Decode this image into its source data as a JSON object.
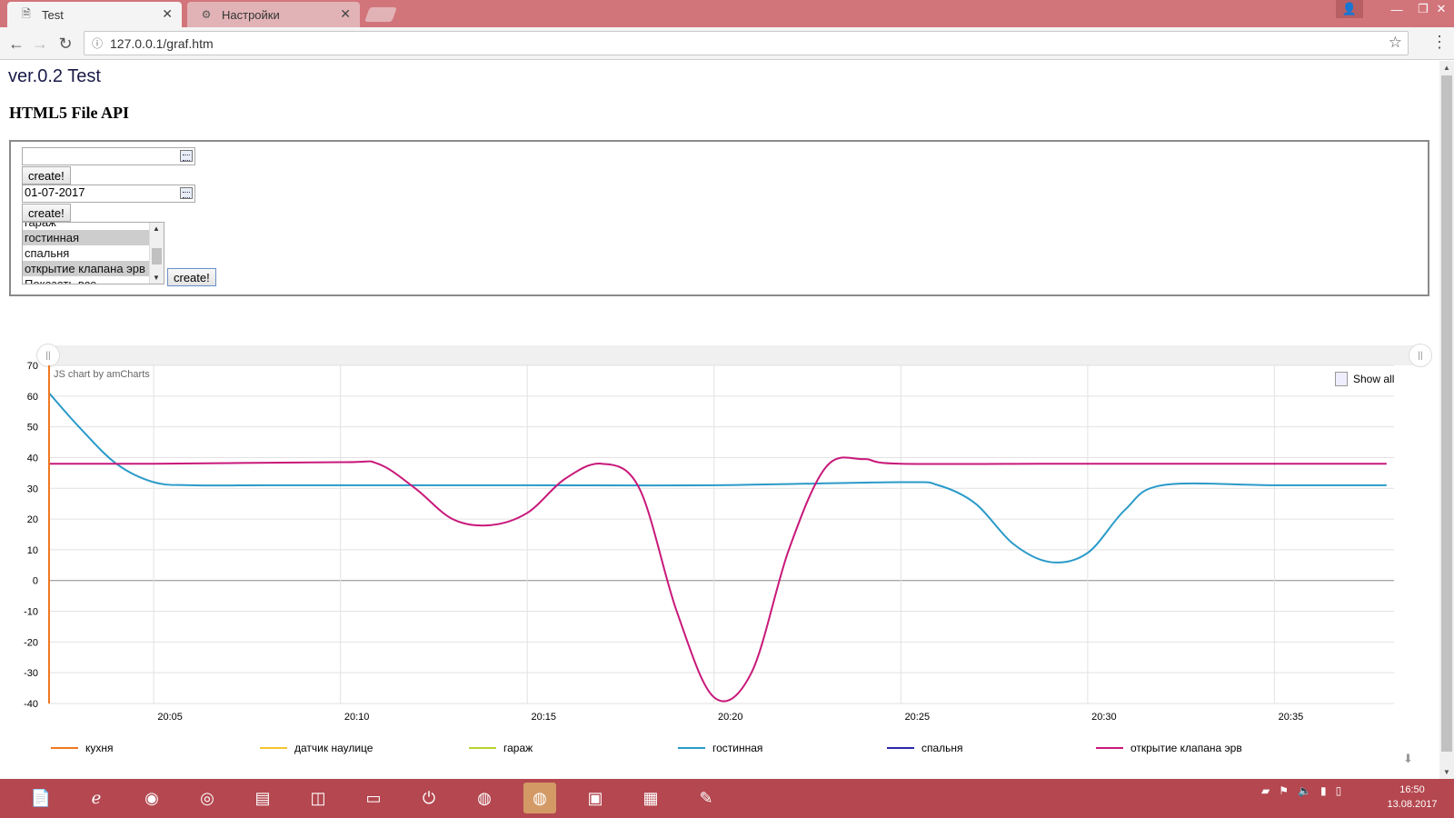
{
  "browser": {
    "tabs": [
      {
        "title": "Test",
        "icon": "page-icon"
      },
      {
        "title": "Настройки",
        "icon": "gear-icon"
      }
    ],
    "url": "127.0.0.1/graf.htm"
  },
  "page": {
    "version": "ver.0.2 Test",
    "heading": "HTML5 File API",
    "form": {
      "date1_value": "",
      "date2_value": "01-07-2017",
      "create_label": "create!",
      "list_options": [
        "гараж",
        "гостинная",
        "спальня",
        "открытие клапана эрв",
        "Показать все"
      ],
      "list_selected": [
        "гостинная",
        "открытие клапана эрв"
      ]
    }
  },
  "chart_credit": "JS chart by amCharts",
  "show_all_label": "Show all",
  "legend": [
    {
      "name": "кухня",
      "color": "#f07820"
    },
    {
      "name": "датчик наулице",
      "color": "#f4c430"
    },
    {
      "name": "гараж",
      "color": "#b9d12d"
    },
    {
      "name": "гостинная",
      "color": "#2a9ac9"
    },
    {
      "name": "спальня",
      "color": "#2a2aa8"
    },
    {
      "name": "открытие клапана эрв",
      "color": "#c8187a"
    }
  ],
  "chart_data": {
    "type": "line",
    "x_ticks": [
      "20:05",
      "20:10",
      "20:15",
      "20:20",
      "20:25",
      "20:30",
      "20:35"
    ],
    "y_ticks": [
      70,
      60,
      50,
      40,
      30,
      20,
      10,
      0,
      -10,
      -20,
      -30,
      -40
    ],
    "ylim": [
      -40,
      70
    ],
    "xlim_minutes": [
      2.2,
      38.2
    ],
    "series": [
      {
        "name": "гостинная",
        "color": "#2a9ac9",
        "x": [
          "20:02",
          "20:03",
          "20:04",
          "20:05",
          "20:06",
          "20:08",
          "20:10",
          "20:15",
          "20:20",
          "20:25",
          "20:26",
          "20:27",
          "20:28",
          "20:29",
          "20:30",
          "20:31",
          "20:32",
          "20:35",
          "20:38"
        ],
        "y": [
          61,
          50,
          38,
          32,
          31,
          31,
          31,
          31,
          31,
          32,
          31,
          25,
          12,
          6,
          9,
          23,
          31,
          31,
          31
        ]
      },
      {
        "name": "открытие клапана эрв",
        "color": "#c8187a",
        "x": [
          "20:02",
          "20:05",
          "20:10",
          "20:11",
          "20:12",
          "20:13",
          "20:14",
          "20:15",
          "20:16",
          "20:17",
          "20:18",
          "20:19",
          "20:20",
          "20:21",
          "20:22",
          "20:23",
          "20:24",
          "20:25",
          "20:30",
          "20:38"
        ],
        "y": [
          38,
          38,
          38.5,
          38,
          30,
          20,
          18,
          22,
          33,
          38,
          30,
          -10,
          -38,
          -30,
          10,
          37,
          39.5,
          38,
          38,
          38
        ]
      },
      {
        "name": "кухня",
        "color": "#f07820",
        "x": [
          "20:02",
          "20:02"
        ],
        "y": [
          -40,
          70
        ]
      }
    ]
  },
  "taskbar": {
    "clock_time": "16:50",
    "clock_date": "13.08.2017"
  }
}
